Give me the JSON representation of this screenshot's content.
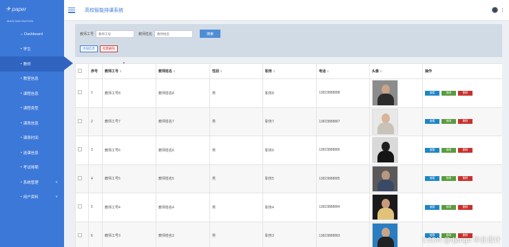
{
  "sidebar": {
    "logo": "paper",
    "nav_title": "MAIN NAVIGATION",
    "items": [
      {
        "icon": "⌂",
        "label": "Dashboard"
      },
      {
        "icon": "▪",
        "label": "学生"
      },
      {
        "icon": "▪",
        "label": "教师"
      },
      {
        "icon": "▪",
        "label": "教室信息"
      },
      {
        "icon": "▪",
        "label": "课程信息"
      },
      {
        "icon": "▪",
        "label": "课程类型"
      },
      {
        "icon": "▪",
        "label": "课表信息"
      },
      {
        "icon": "▪",
        "label": "课表时间"
      },
      {
        "icon": "▪",
        "label": "选课信息"
      },
      {
        "icon": "▪",
        "label": "考试排期"
      },
      {
        "icon": "▪",
        "label": "系统管理"
      },
      {
        "icon": "▪",
        "label": "用户资料"
      }
    ]
  },
  "header": {
    "title": "高校智能排课系统"
  },
  "search": {
    "label_id": "教师工号",
    "placeholder_id": "教师工号",
    "label_name": "教师姓名",
    "placeholder_name": "教师姓名",
    "search_button": "搜索",
    "add_button": "添加信息",
    "batch_delete_button": "批量删除"
  },
  "table": {
    "headers": [
      "序号",
      "教师工号",
      "教师姓名",
      "性别",
      "职务",
      "电话",
      "头像",
      "操作"
    ],
    "rows": [
      {
        "no": "1",
        "id": "教师工号8",
        "name": "教师姓名8",
        "gender": "男",
        "title": "职务8",
        "phone": "13823888888"
      },
      {
        "no": "2",
        "id": "教师工号7",
        "name": "教师姓名7",
        "gender": "男",
        "title": "职务7",
        "phone": "13823888887"
      },
      {
        "no": "3",
        "id": "教师工号6",
        "name": "教师姓名6",
        "gender": "男",
        "title": "职务6",
        "phone": "13823888886"
      },
      {
        "no": "4",
        "id": "教师工号5",
        "name": "教师姓名5",
        "gender": "男",
        "title": "职务5",
        "phone": "13823888885"
      },
      {
        "no": "5",
        "id": "教师工号4",
        "name": "教师姓名4",
        "gender": "男",
        "title": "职务4",
        "phone": "13823888884"
      },
      {
        "no": "6",
        "id": "教师工号3",
        "name": "教师姓名3",
        "gender": "男",
        "title": "职务3",
        "phone": "13823888883"
      }
    ],
    "op_view": "查看",
    "op_edit": "修改",
    "op_delete": "删除"
  },
  "watermark": "CSDN @django 毕业设计",
  "colors": {
    "accent": "#3c78d8",
    "sidebar": "#3c78d8",
    "view": "#1f86c5",
    "edit": "#5b9b3f",
    "delete": "#c9302c"
  }
}
